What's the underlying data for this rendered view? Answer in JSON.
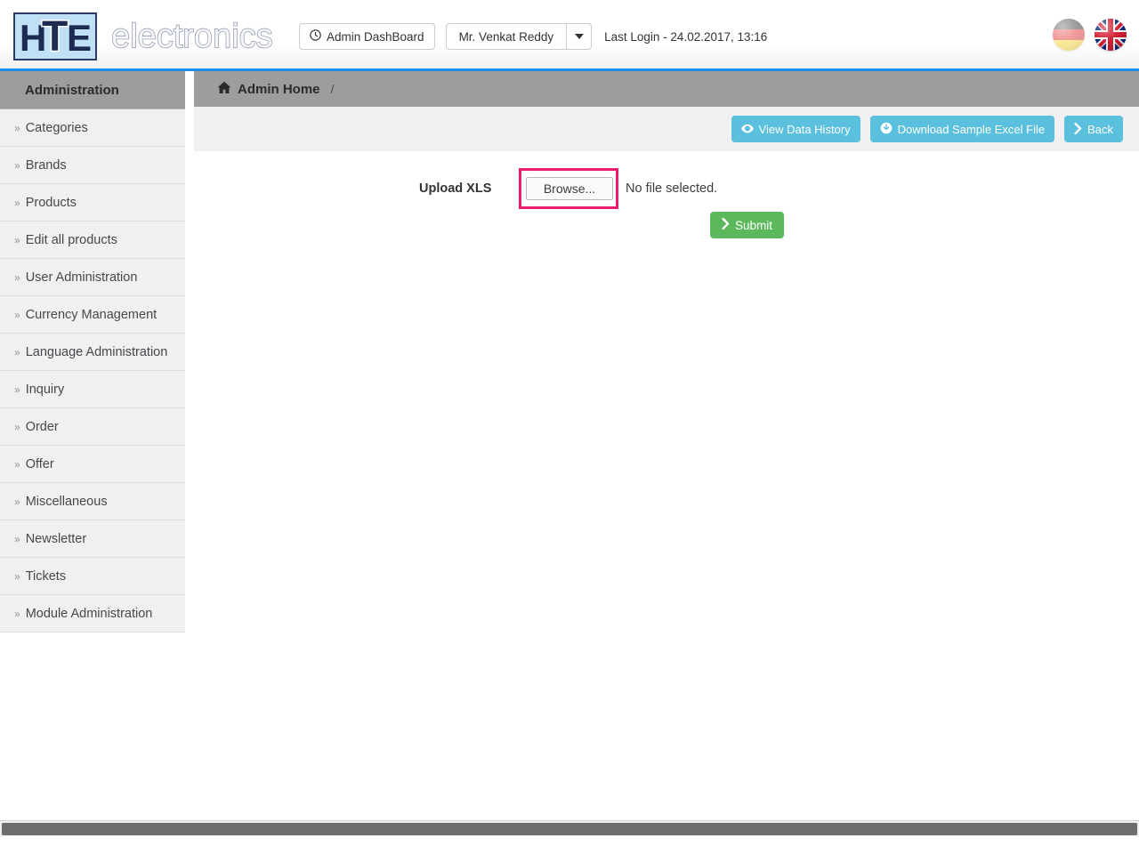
{
  "header": {
    "logo": {
      "mark_h": "H",
      "mark_t": "T",
      "mark_e": "E",
      "wordmark": "electronics"
    },
    "dashboard_button": {
      "label": "Admin DashBoard",
      "icon": "clock-icon"
    },
    "user_button": {
      "label": "Mr. Venkat Reddy",
      "caret_icon": "chevron-down-icon"
    },
    "last_login": "Last Login - 24.02.2017, 13:16",
    "flags": [
      {
        "name": "german-flag",
        "title": "Deutsch"
      },
      {
        "name": "uk-flag",
        "title": "English"
      }
    ],
    "accent_color": "#1c8ceb"
  },
  "sidebar": {
    "title": "Administration",
    "bullet": "»",
    "items": [
      {
        "label": "Categories"
      },
      {
        "label": "Brands"
      },
      {
        "label": "Products"
      },
      {
        "label": "Edit all products"
      },
      {
        "label": "User Administration"
      },
      {
        "label": "Currency Management"
      },
      {
        "label": "Language Administration"
      },
      {
        "label": "Inquiry"
      },
      {
        "label": "Order"
      },
      {
        "label": "Offer"
      },
      {
        "label": "Miscellaneous"
      },
      {
        "label": "Newsletter"
      },
      {
        "label": "Tickets"
      },
      {
        "label": "Module Administration"
      }
    ]
  },
  "breadcrumb": {
    "home_icon": "home-icon",
    "home_label": "Admin Home",
    "separator": "/"
  },
  "toolbar": {
    "view_history_label": "View Data History",
    "view_history_icon": "eye-icon",
    "download_sample_label": "Download Sample Excel File",
    "download_sample_icon": "download-circle-icon",
    "back_label": "Back",
    "back_icon": "chevron-right-icon",
    "button_color": "#5bc0de"
  },
  "form": {
    "upload_label": "Upload XLS",
    "browse_button_label": "Browse...",
    "file_status": "No file selected.",
    "highlight_color": "#ea1c6b",
    "submit_label": "Submit",
    "submit_icon": "chevron-right-icon",
    "submit_color": "#5cb85c"
  },
  "scrollbar": {
    "orientation": "horizontal"
  }
}
